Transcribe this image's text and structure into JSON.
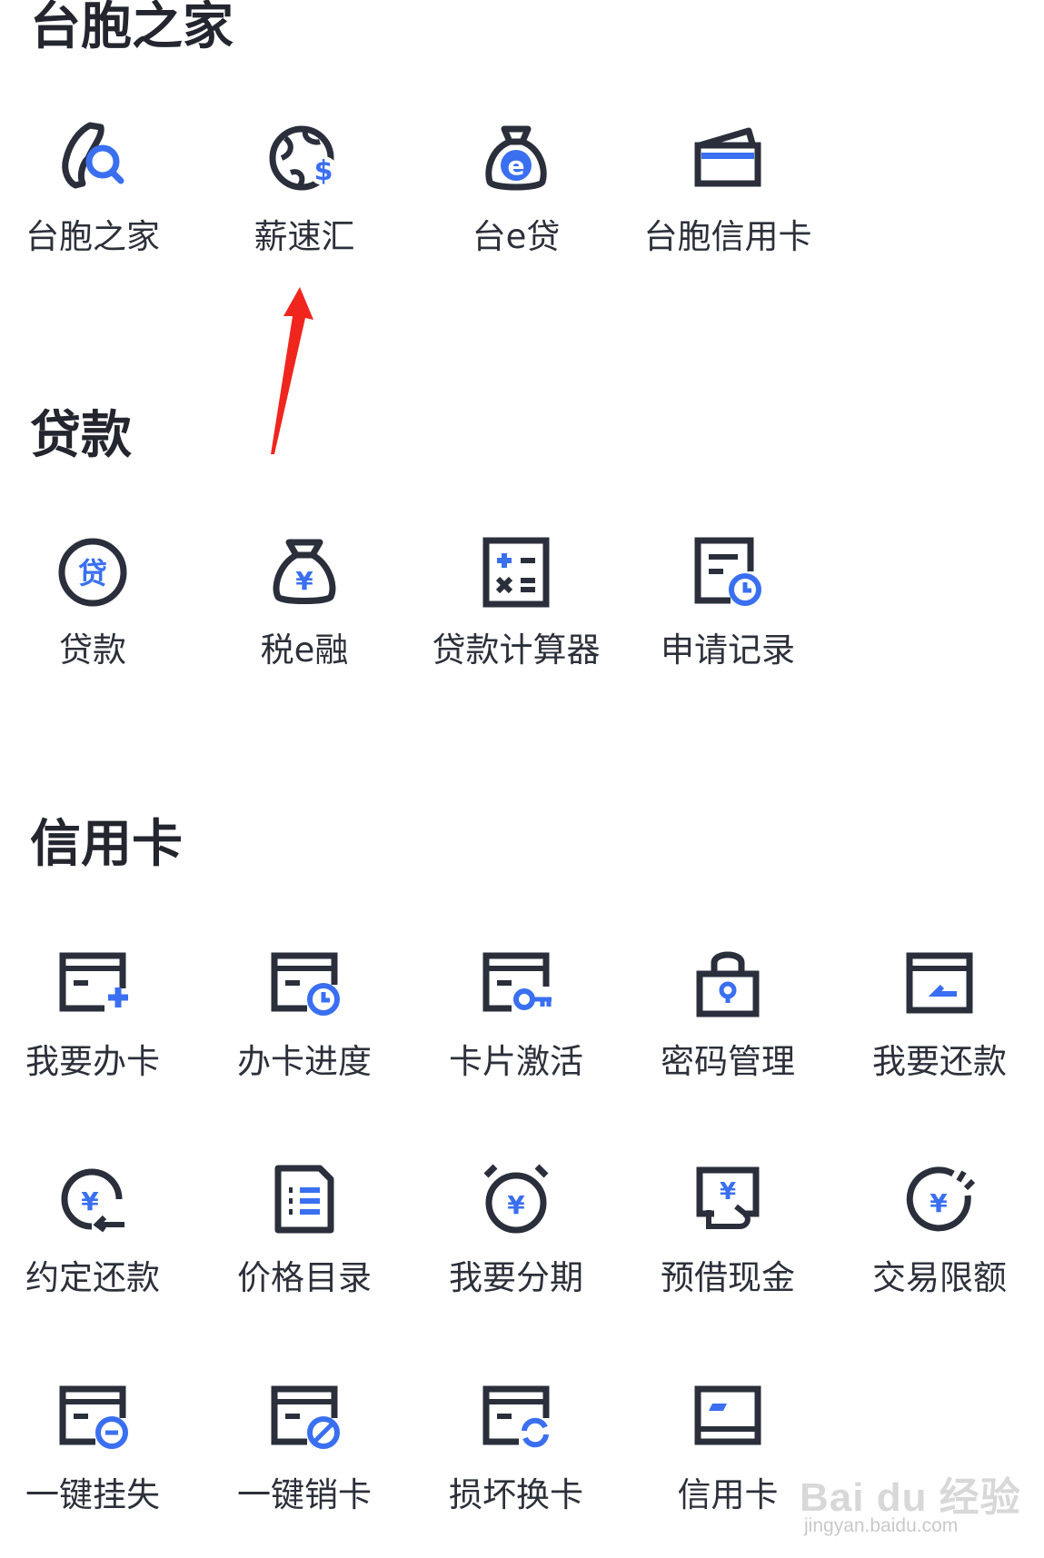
{
  "sections": [
    {
      "title": "台胞之家",
      "items": [
        {
          "label": "台胞之家",
          "icon": "taiwan-search-icon"
        },
        {
          "label": "薪速汇",
          "icon": "globe-dollar-icon"
        },
        {
          "label": "台e贷",
          "icon": "money-bag-e-icon"
        },
        {
          "label": "台胞信用卡",
          "icon": "wallet-card-icon"
        }
      ]
    },
    {
      "title": "贷款",
      "items": [
        {
          "label": "贷款",
          "icon": "loan-circle-icon"
        },
        {
          "label": "税e融",
          "icon": "yuan-bag-icon"
        },
        {
          "label": "贷款计算器",
          "icon": "calculator-icon"
        },
        {
          "label": "申请记录",
          "icon": "record-clock-icon"
        }
      ]
    },
    {
      "title": "信用卡",
      "items": [
        {
          "label": "我要办卡",
          "icon": "card-plus-icon"
        },
        {
          "label": "办卡进度",
          "icon": "card-clock-icon"
        },
        {
          "label": "卡片激活",
          "icon": "card-key-icon"
        },
        {
          "label": "密码管理",
          "icon": "lock-icon"
        },
        {
          "label": "我要还款",
          "icon": "card-return-icon"
        },
        {
          "label": "约定还款",
          "icon": "yuan-cycle-icon"
        },
        {
          "label": "价格目录",
          "icon": "list-document-icon"
        },
        {
          "label": "我要分期",
          "icon": "yuan-alarm-icon"
        },
        {
          "label": "预借现金",
          "icon": "yuan-withdraw-icon"
        },
        {
          "label": "交易限额",
          "icon": "yuan-gauge-icon"
        },
        {
          "label": "一键挂失",
          "icon": "card-minus-icon"
        },
        {
          "label": "一键销卡",
          "icon": "card-cancel-icon"
        },
        {
          "label": "损坏换卡",
          "icon": "card-refresh-icon"
        },
        {
          "label": "信用卡",
          "icon": "credit-card-icon"
        }
      ]
    }
  ],
  "watermark": {
    "brand": "Bai du 经验",
    "url": "jingyan.baidu.com"
  },
  "colors": {
    "icon_dark": "#2a2f3b",
    "accent": "#3a6ff0",
    "arrow": "#f0261e"
  }
}
